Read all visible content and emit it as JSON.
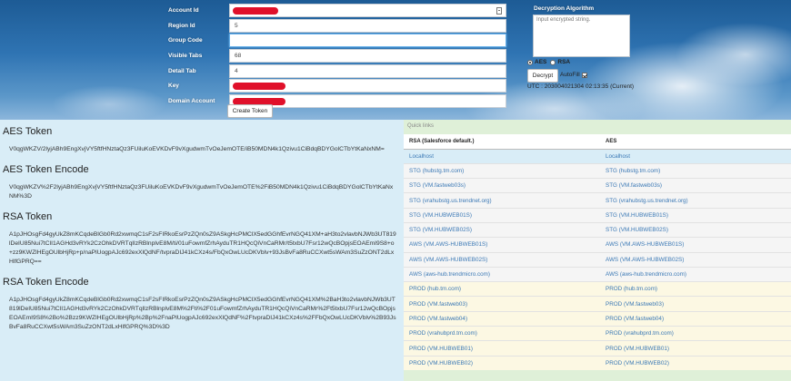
{
  "form": {
    "fields": [
      {
        "label": "Account Id",
        "value": "",
        "redacted": true,
        "icon": "document-icon"
      },
      {
        "label": "Region Id",
        "value": "5"
      },
      {
        "label": "Group Code",
        "value": ""
      },
      {
        "label": "Visible Tabs",
        "value": "68"
      },
      {
        "label": "Detail Tab",
        "value": "4"
      },
      {
        "label": "Key",
        "value": "",
        "redacted": true
      },
      {
        "label": "Domain Account",
        "value": "",
        "redacted": true
      }
    ],
    "create_button": "Create Token"
  },
  "decrypt": {
    "title": "Decryption Algorithm",
    "placeholder": "Input encrypted string.",
    "radio_aes": "AES",
    "radio_rsa": "RSA",
    "selected": "AES",
    "decrypt_button": "Decrypt",
    "autofill_label": "AutoFill",
    "autofill_checked": true,
    "utc": "UTC : 20300402130​4 02:13:35 (Current)"
  },
  "tokens": [
    {
      "heading": "AES Token",
      "value": "V0qgWKZV/2lyjABh9EngXvjVY5ftfHNztaQz3FUiluKoEVKDvF9vXgudwmTvOeJemOTE/iB50MDN4k1Qzivu1CiBdqBDYGolCTbYtKaNxNM="
    },
    {
      "heading": "AES Token Encode",
      "value": "V0qgWKZV%2F2lyjABh9EngXvjVY5ftfHNztaQz3FUiluKoEVKDvF9vXgudwmTvOeJemOTE%2FiB50MDN4k1Qzivu1CiBdqBDYGolCTbYtKaNxNM%3D"
    },
    {
      "heading": "RSA Token",
      "value": "A1pJHOsgFd4gyUkZ8mKCqdeBlGb0Rd2xwmqC1sF2sFIRkoEsrPzZQn0sZ9ASkgHcPMClX5edGGhfEvrNGQ41XM+aH3to2vlavbNJWb3UT819lDeIU85Nui7tClI1AGHd3vRYk2CzOhkDVRTqlIzRBlnplvE8M/ti/01uFowmfZrhAyduTR1HQcQiVnCaRMr/t5txbU7Fsr12wQcBOpjsEOAEmI9S8+o+zz9KWZlHEgOUlbHjRp+p/naPlUogpAJc692exXlQdNF/tvpraDIJ41kCXz4s/FbQxOwLUcDKVblv+93JsBvFa8RuCCXwt5sWAm3SuZzONT2dLxHlfGPRQ=="
    },
    {
      "heading": "RSA Token Encode",
      "value": "A1pJHOsgFd4gyUkZ8mKCqdeBlGb0Rd2xwmqC1sF2sFIRkoEsrPzZQn0sZ9ASkgHcPMClX5edGGhfEvrNGQ41XM%2BaH3to2vlavbNJWb3UT819lDeIU85Nui7tClI1AGHd3vRYk2CzOhkDVRTqlIzRBlnplvE8M%2Fti%2F01uFowmfZrhAyduTR1HQcQiVnCaRMr%2Ft5txbU7Fsr12wQcBOpjsEOAEmI9S8%2Bo%2Bzz9KWZlHEgOUlbHjRp%2Bp%2FnaPlUogpAJc692exXlQdNF%2FtvpraDIJ41kCXz4s%2FFbQxOwLUcDKVblv%2B93JsBvFa8RuCCXwt5sWAm3SuZzONT2dLxHlfGPRQ%3D%3D"
    }
  ],
  "quick_links": {
    "title": "Quick links",
    "headers": [
      "RSA (Salesforce default.)",
      "AES"
    ],
    "rows": [
      {
        "style": "blue",
        "rsa": "Localhost",
        "aes": "Localhost"
      },
      {
        "style": "grey",
        "rsa": "STG (hubstg.tm.com)",
        "aes": "STG (hubstg.tm.com)"
      },
      {
        "style": "grey",
        "rsa": "STG (VM.fastweb03s)",
        "aes": "STG (VM.fastweb03s)"
      },
      {
        "style": "grey",
        "rsa": "STG (vrahubstg.us.trendnet.org)",
        "aes": "STG (vrahubstg.us.trendnet.org)"
      },
      {
        "style": "grey",
        "rsa": "STG (VM.HUBWEB01S)",
        "aes": "STG (VM.HUBWEB01S)"
      },
      {
        "style": "grey",
        "rsa": "STG (VM.HUBWEB02S)",
        "aes": "STG (VM.HUBWEB02S)"
      },
      {
        "style": "grey",
        "rsa": "AWS (VM.AWS-HUBWEB01S)",
        "aes": "AWS (VM.AWS-HUBWEB01S)"
      },
      {
        "style": "grey",
        "rsa": "AWS (VM.AWS-HUBWEB02S)",
        "aes": "AWS (VM.AWS-HUBWEB02S)"
      },
      {
        "style": "grey",
        "rsa": "AWS (aws-hub.trendmicro.com)",
        "aes": "AWS (aws-hub.trendmicro.com)"
      },
      {
        "style": "yellow",
        "rsa": "PROD (hub.tm.com)",
        "aes": "PROD (hub.tm.com)"
      },
      {
        "style": "yellow",
        "rsa": "PROD (VM.fastweb03)",
        "aes": "PROD (VM.fastweb03)"
      },
      {
        "style": "yellow",
        "rsa": "PROD (VM.fastweb04)",
        "aes": "PROD (VM.fastweb04)"
      },
      {
        "style": "yellow",
        "rsa": "PROD (vrahubprd.tm.com)",
        "aes": "PROD (vrahubprd.tm.com)"
      },
      {
        "style": "yellow",
        "rsa": "PROD (VM.HUBWEB01)",
        "aes": "PROD (VM.HUBWEB01)"
      },
      {
        "style": "yellow",
        "rsa": "PROD (VM.HUBWEB02)",
        "aes": "PROD (VM.HUBWEB02)"
      }
    ]
  }
}
